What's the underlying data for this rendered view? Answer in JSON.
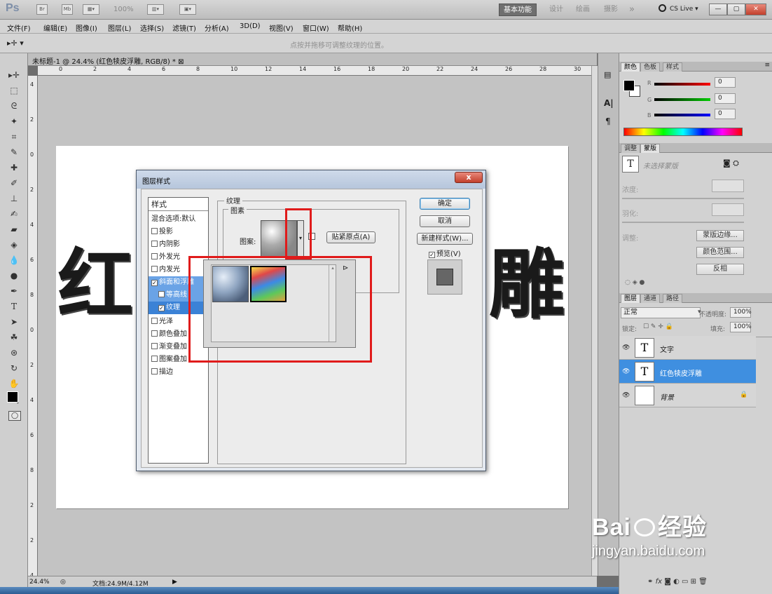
{
  "app": {
    "logo": "Ps",
    "zoom_menu": "100%",
    "workspaces": [
      "基本功能",
      "设计",
      "绘画",
      "摄影",
      "»"
    ],
    "cslive": "CS Live ▾",
    "win_buttons": [
      "—",
      "▢",
      "✕"
    ]
  },
  "menu": [
    "文件(F)",
    "编辑(E)",
    "图像(I)",
    "图层(L)",
    "选择(S)",
    "滤镜(T)",
    "分析(A)",
    "3D(D)",
    "视图(V)",
    "窗口(W)",
    "帮助(H)"
  ],
  "options_hint": "点按并拖移可调整纹理的位置。",
  "doc_tab": "未标题-1 @ 24.4% (红色犊皮浮雕, RGB/8) * ⊠",
  "ruler_h": [
    "0",
    "2",
    "4",
    "6",
    "8",
    "10",
    "12",
    "14",
    "16",
    "18",
    "20",
    "22",
    "24",
    "26",
    "28",
    "30"
  ],
  "ruler_v": [
    "4",
    "2",
    "0",
    "2",
    "4",
    "6",
    "8",
    "0",
    "2",
    "4",
    "6",
    "8",
    "2",
    "2",
    "4"
  ],
  "canvas_text_left": "红",
  "canvas_text_right": "雕",
  "status": {
    "zoom": "24.4%",
    "doc": "文档:24.9M/4.12M"
  },
  "color_panel": {
    "tabs": [
      "颜色",
      "色板",
      "样式"
    ],
    "channels": [
      {
        "label": "R",
        "value": "0"
      },
      {
        "label": "G",
        "value": "0"
      },
      {
        "label": "B",
        "value": "0"
      }
    ]
  },
  "adjust_panel": {
    "tabs": [
      "调整",
      "蒙版"
    ],
    "mask_label": "未选择蒙版",
    "density_label": "浓度:",
    "feather_label": "羽化:",
    "refine_label": "调整:",
    "buttons": [
      "蒙版边缘...",
      "颜色范围...",
      "反相"
    ]
  },
  "layers_panel": {
    "tabs": [
      "图层",
      "通道",
      "路径"
    ],
    "blend_mode": "正常",
    "opacity_label": "不透明度:",
    "opacity": "100%",
    "lock_label": "锁定:",
    "fill_label": "填充:",
    "fill": "100%",
    "layers": [
      {
        "name": "文字",
        "thumb": "T"
      },
      {
        "name": "红色犊皮浮雕",
        "thumb": "T"
      },
      {
        "name": "背景",
        "thumb": ""
      }
    ],
    "footer": "fx"
  },
  "dialog": {
    "title": "图层样式",
    "close": "x",
    "styles_header": "样式",
    "blend_options": "混合选项:默认",
    "items": [
      "投影",
      "内阴影",
      "外发光",
      "内发光",
      "斜面和浮雕",
      "等高线",
      "纹理",
      "光泽",
      "颜色叠加",
      "渐变叠加",
      "图案叠加",
      "描边"
    ],
    "section_title": "纹理",
    "group_title": "图素",
    "pattern_label": "图案:",
    "snap_button": "贴紧原点(A)",
    "buttons": {
      "ok": "确定",
      "cancel": "取消",
      "new_style": "新建样式(W)...",
      "preview": "预览(V)"
    }
  },
  "watermark": {
    "brand": "Bai",
    "brand2": "经验",
    "url": "jingyan.baidu.com"
  }
}
